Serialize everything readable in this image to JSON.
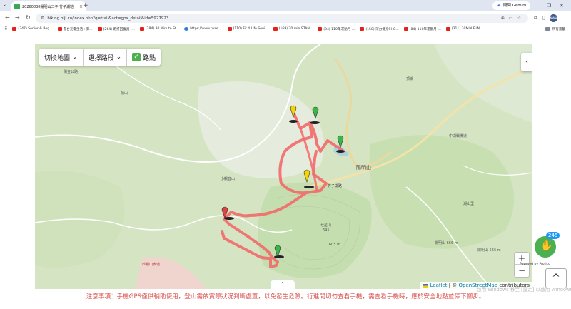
{
  "browser": {
    "tab_title": "20260830陽明山二子 竹子湖地",
    "tab_close": "×",
    "new_tab": "+",
    "gemini_label": "問問 Gemini",
    "url": "hiking.biji.co/index.php?q=trail&act=gpx_detail&id=5927923",
    "profile_initials": "NWH"
  },
  "bookmarks": {
    "items": [
      {
        "label": "(347) Senior & Beg...",
        "icon": "youtube-icon"
      },
      {
        "label": "雲台光電生活 : 東...",
        "icon": "youtube-icon"
      },
      {
        "label": "(264) 跑打回復員 |...",
        "icon": "youtube-icon"
      },
      {
        "label": "(284) 30 Minute St...",
        "icon": "youtube-icon"
      },
      {
        "label": "https://www.twse....",
        "icon": "globe-icon"
      },
      {
        "label": "(110) Fit 4 Life Seni...",
        "icon": "youtube-icon"
      },
      {
        "label": "(169) 20 min STAN...",
        "icon": "youtube-icon"
      },
      {
        "label": "(84) 110年運動月-...",
        "icon": "youtube-icon"
      },
      {
        "label": "(158) 深力健身SHO...",
        "icon": "youtube-icon"
      },
      {
        "label": "(84) 110年運動月-...",
        "icon": "youtube-icon"
      },
      {
        "label": "(311) 30MIN FUN...",
        "icon": "youtube-icon"
      }
    ],
    "all_bookmarks": "所有書籤"
  },
  "map_controls": {
    "switch_map": "切換地圖",
    "select_route": "選擇路段",
    "waypoints": "路點",
    "waypoints_checked": true,
    "zoom_in": "+",
    "zoom_out": "−"
  },
  "map_labels": {
    "district": "陽明山",
    "road1": "竹子湖路",
    "road2": "中湖戰備道",
    "road3": "陽金公路",
    "peak_ding": "頂山",
    "peak_small": "小觀音山",
    "station": "楊明山 666 m",
    "peak1_name": "七星山",
    "peak1_alt": "645",
    "peak2_alt": "605 m",
    "village": "頂湖",
    "residence": "湖山里",
    "lake": "纱帽山",
    "neighborhood": "陽明山 566 m",
    "area_label": "紗帽山步道"
  },
  "attribution": {
    "leaflet": "Leaflet",
    "separator": " | © ",
    "osm": "OpenStreetMap",
    "contrib": " contributors"
  },
  "page": {
    "notice": "注意事項：手機GPS僅供輔助使用，登山需依實際狀況判斷處置，以免發生危險。行進間切勿查看手機，需查看手機時，應於安全地點並停下腳步。",
    "watermark": "啟用 Windows 移至 [設定] 以啟用 Windows。",
    "badge_count": "245",
    "powered_by": "Powered by Protico",
    "scroll_top": "^"
  },
  "colors": {
    "track": "#f26a6a",
    "map_bg": "#d7e6c5",
    "notice": "#d9534f"
  }
}
